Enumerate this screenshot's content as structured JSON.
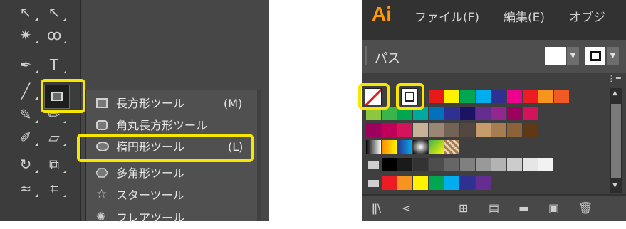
{
  "left_panel": {
    "tools": [
      {
        "name": "selection-tool",
        "glyph": "↖"
      },
      {
        "name": "direct-selection-tool",
        "glyph": "↖"
      },
      {
        "name": "magic-wand-tool",
        "glyph": "✷"
      },
      {
        "name": "lasso-tool",
        "glyph": "ꝏ"
      },
      {
        "name": "pen-tool",
        "glyph": "✒"
      },
      {
        "name": "type-tool",
        "glyph": "T"
      },
      {
        "name": "line-tool",
        "glyph": "╱"
      },
      {
        "name": "rectangle-tool",
        "glyph": "▭"
      },
      {
        "name": "paintbrush-tool",
        "glyph": "✎"
      },
      {
        "name": "pencil-tool",
        "glyph": "✏"
      },
      {
        "name": "shaper-tool",
        "glyph": "✐"
      },
      {
        "name": "eraser-tool",
        "glyph": "▱"
      },
      {
        "name": "rotate-tool",
        "glyph": "↻"
      },
      {
        "name": "scale-tool",
        "glyph": "⧉"
      },
      {
        "name": "width-tool",
        "glyph": "≈"
      },
      {
        "name": "free-transform-tool",
        "glyph": "⌗"
      }
    ],
    "flyout": [
      {
        "label": "長方形ツール",
        "shortcut": "(M)",
        "icon": "rectangle-icon"
      },
      {
        "label": "角丸長方形ツール",
        "shortcut": "",
        "icon": "rounded-rectangle-icon"
      },
      {
        "label": "楕円形ツール",
        "shortcut": "(L)",
        "icon": "ellipse-icon"
      },
      {
        "label": "多角形ツール",
        "shortcut": "",
        "icon": "polygon-icon"
      },
      {
        "label": "スターツール",
        "shortcut": "",
        "icon": "star-icon"
      },
      {
        "label": "フレアツール",
        "shortcut": "",
        "icon": "flare-icon"
      }
    ]
  },
  "right_panel": {
    "logo": "Ai",
    "menu": [
      "ファイル(F)",
      "編集(E)",
      "オブジ"
    ],
    "panel_title": "パス",
    "colors": {
      "row1": [
        "#ffffff",
        "#000000",
        "#e81919",
        "#fff200",
        "#00a651",
        "#00aeef",
        "#2e3192",
        "#ec008c",
        "#ed1c24",
        "#f7941d",
        "#f15a24"
      ],
      "row2": [
        "#8dc63f",
        "#39b54a",
        "#00a651",
        "#00a99d",
        "#0072bc",
        "#2e3192",
        "#1b1464",
        "#662d91",
        "#92278f",
        "#9e005d",
        "#d4145a"
      ],
      "row3": [
        "#9e005d",
        "#c1005a",
        "#d4145a",
        "#c7b299",
        "#998675",
        "#736357",
        "#534741",
        "#c69c6d",
        "#a67c52",
        "#8c6239",
        "#603813"
      ],
      "gray_row": [
        "#000000",
        "#1a1a1a",
        "#333333",
        "#4d4d4d",
        "#666666",
        "#808080",
        "#999999",
        "#b3b3b3",
        "#cccccc",
        "#e6e6e6",
        "#f2f2f2"
      ],
      "bright_row": [
        "#ed1c24",
        "#f7941d",
        "#fff200",
        "#00a651",
        "#00aeef",
        "#2e3192",
        "#662d91"
      ]
    }
  }
}
